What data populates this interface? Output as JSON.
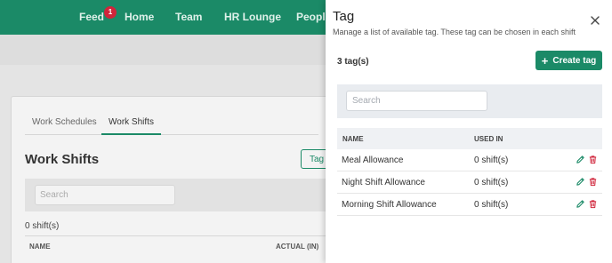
{
  "topnav": {
    "items": [
      {
        "label": "Feed",
        "badge": "1"
      },
      {
        "label": "Home"
      },
      {
        "label": "Team"
      },
      {
        "label": "HR Lounge"
      },
      {
        "label": "People"
      }
    ]
  },
  "background": {
    "tabs": [
      "Work Schedules",
      "Work Shifts"
    ],
    "active_tab": "Work Shifts",
    "title": "Work Shifts",
    "tag_button": "Tag",
    "search_placeholder": "Search",
    "count": "0 shift(s)",
    "columns": [
      "NAME",
      "ACTUAL (IN)"
    ]
  },
  "drawer": {
    "title": "Tag",
    "subtitle": "Manage a list of available tag. These tag can be chosen in each shift",
    "close_icon": "close-icon",
    "count": "3 tag(s)",
    "create_label": "Create tag",
    "search_placeholder": "Search",
    "search_value": "",
    "columns": {
      "name": "NAME",
      "used_in": "USED IN"
    },
    "rows": [
      {
        "name": "Meal Allowance",
        "used_in": "0 shift(s)"
      },
      {
        "name": "Night Shift Allowance",
        "used_in": "0 shift(s)"
      },
      {
        "name": "Morning Shift Allowance",
        "used_in": "0 shift(s)"
      }
    ]
  },
  "colors": {
    "primary": "#1b8a67",
    "badge": "#d0253b",
    "delete": "#d0253b",
    "edit": "#1b8a67"
  }
}
